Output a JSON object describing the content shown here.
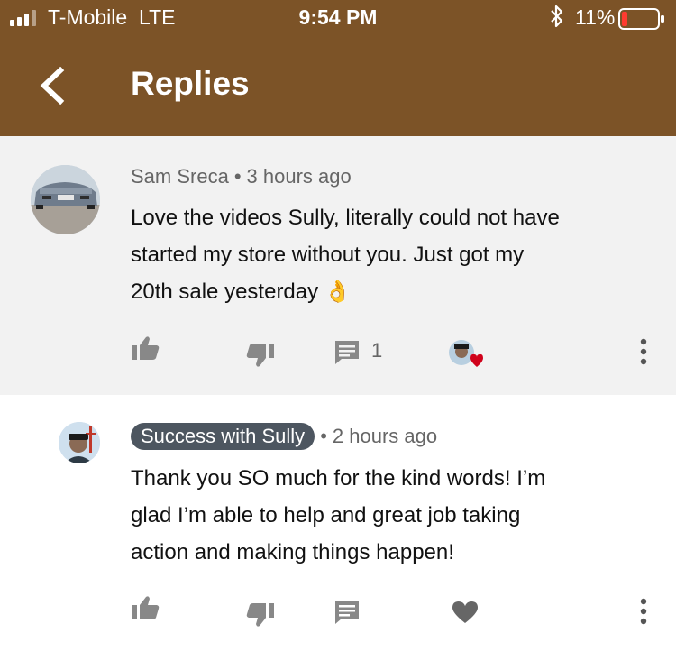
{
  "status": {
    "carrier": "T-Mobile",
    "network": "LTE",
    "time": "9:54 PM",
    "battery": "11%"
  },
  "header": {
    "title": "Replies"
  },
  "comments": [
    {
      "author": "Sam Sreca",
      "time": "3 hours ago",
      "lines": [
        "Love the videos Sully, literally could not have",
        "started my store without you. Just got my",
        "20th sale yesterday"
      ],
      "emoji": "👌",
      "reply_count": "1"
    },
    {
      "author": "Success with Sully",
      "time": "2 hours ago",
      "lines": [
        "Thank you SO much for the kind words! I’m",
        "glad I’m able to help and great job taking",
        "action and making things happen!"
      ]
    }
  ],
  "colors": {
    "header": "#7c5327",
    "comment_bg": "#f2f2f2",
    "heart": "#d0021b",
    "pill": "#4d5660"
  },
  "icons": [
    "chevron-left-icon",
    "thumbs-up-icon",
    "thumbs-down-icon",
    "reply-icon",
    "heart-icon",
    "more-vertical-icon",
    "bluetooth-icon",
    "battery-icon",
    "signal-icon"
  ]
}
